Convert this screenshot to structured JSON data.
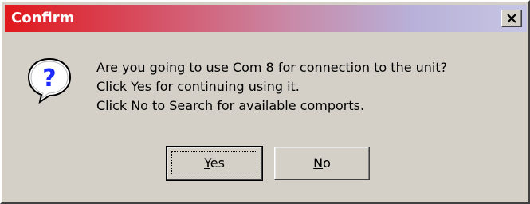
{
  "window": {
    "title": "Confirm",
    "close_label": "Close"
  },
  "message": {
    "lines": [
      "Are you going to use Com 8 for connection to the unit?",
      "Click Yes for continuing using it.",
      "Click No to Search for available comports."
    ],
    "icon": "question-icon"
  },
  "buttons": {
    "yes": {
      "mnemonic": "Y",
      "rest": "es"
    },
    "no": {
      "mnemonic": "N",
      "rest": "o"
    }
  },
  "colors": {
    "titlebar_start": "#e0181c",
    "titlebar_end": "#c6c6e4",
    "face": "#d4d0c8",
    "icon_blue": "#1c2cff"
  }
}
